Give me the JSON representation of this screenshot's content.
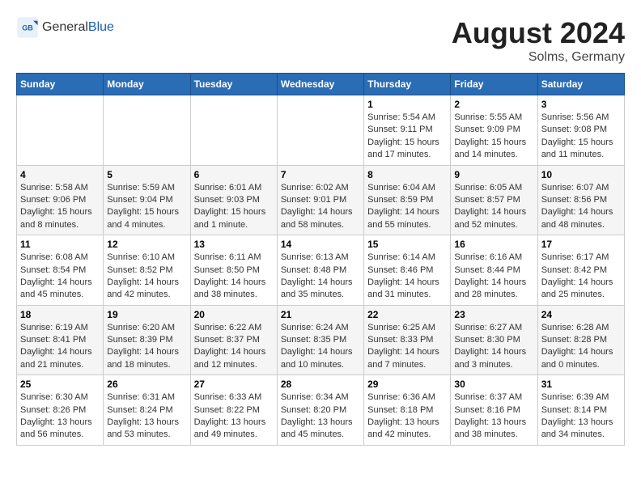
{
  "header": {
    "logo_general": "General",
    "logo_blue": "Blue",
    "month_year": "August 2024",
    "location": "Solms, Germany"
  },
  "weekdays": [
    "Sunday",
    "Monday",
    "Tuesday",
    "Wednesday",
    "Thursday",
    "Friday",
    "Saturday"
  ],
  "weeks": [
    [
      {
        "day": "",
        "info": ""
      },
      {
        "day": "",
        "info": ""
      },
      {
        "day": "",
        "info": ""
      },
      {
        "day": "",
        "info": ""
      },
      {
        "day": "1",
        "info": "Sunrise: 5:54 AM\nSunset: 9:11 PM\nDaylight: 15 hours\nand 17 minutes."
      },
      {
        "day": "2",
        "info": "Sunrise: 5:55 AM\nSunset: 9:09 PM\nDaylight: 15 hours\nand 14 minutes."
      },
      {
        "day": "3",
        "info": "Sunrise: 5:56 AM\nSunset: 9:08 PM\nDaylight: 15 hours\nand 11 minutes."
      }
    ],
    [
      {
        "day": "4",
        "info": "Sunrise: 5:58 AM\nSunset: 9:06 PM\nDaylight: 15 hours\nand 8 minutes."
      },
      {
        "day": "5",
        "info": "Sunrise: 5:59 AM\nSunset: 9:04 PM\nDaylight: 15 hours\nand 4 minutes."
      },
      {
        "day": "6",
        "info": "Sunrise: 6:01 AM\nSunset: 9:03 PM\nDaylight: 15 hours\nand 1 minute."
      },
      {
        "day": "7",
        "info": "Sunrise: 6:02 AM\nSunset: 9:01 PM\nDaylight: 14 hours\nand 58 minutes."
      },
      {
        "day": "8",
        "info": "Sunrise: 6:04 AM\nSunset: 8:59 PM\nDaylight: 14 hours\nand 55 minutes."
      },
      {
        "day": "9",
        "info": "Sunrise: 6:05 AM\nSunset: 8:57 PM\nDaylight: 14 hours\nand 52 minutes."
      },
      {
        "day": "10",
        "info": "Sunrise: 6:07 AM\nSunset: 8:56 PM\nDaylight: 14 hours\nand 48 minutes."
      }
    ],
    [
      {
        "day": "11",
        "info": "Sunrise: 6:08 AM\nSunset: 8:54 PM\nDaylight: 14 hours\nand 45 minutes."
      },
      {
        "day": "12",
        "info": "Sunrise: 6:10 AM\nSunset: 8:52 PM\nDaylight: 14 hours\nand 42 minutes."
      },
      {
        "day": "13",
        "info": "Sunrise: 6:11 AM\nSunset: 8:50 PM\nDaylight: 14 hours\nand 38 minutes."
      },
      {
        "day": "14",
        "info": "Sunrise: 6:13 AM\nSunset: 8:48 PM\nDaylight: 14 hours\nand 35 minutes."
      },
      {
        "day": "15",
        "info": "Sunrise: 6:14 AM\nSunset: 8:46 PM\nDaylight: 14 hours\nand 31 minutes."
      },
      {
        "day": "16",
        "info": "Sunrise: 6:16 AM\nSunset: 8:44 PM\nDaylight: 14 hours\nand 28 minutes."
      },
      {
        "day": "17",
        "info": "Sunrise: 6:17 AM\nSunset: 8:42 PM\nDaylight: 14 hours\nand 25 minutes."
      }
    ],
    [
      {
        "day": "18",
        "info": "Sunrise: 6:19 AM\nSunset: 8:41 PM\nDaylight: 14 hours\nand 21 minutes."
      },
      {
        "day": "19",
        "info": "Sunrise: 6:20 AM\nSunset: 8:39 PM\nDaylight: 14 hours\nand 18 minutes."
      },
      {
        "day": "20",
        "info": "Sunrise: 6:22 AM\nSunset: 8:37 PM\nDaylight: 14 hours\nand 12 minutes."
      },
      {
        "day": "21",
        "info": "Sunrise: 6:24 AM\nSunset: 8:35 PM\nDaylight: 14 hours\nand 10 minutes."
      },
      {
        "day": "22",
        "info": "Sunrise: 6:25 AM\nSunset: 8:33 PM\nDaylight: 14 hours\nand 7 minutes."
      },
      {
        "day": "23",
        "info": "Sunrise: 6:27 AM\nSunset: 8:30 PM\nDaylight: 14 hours\nand 3 minutes."
      },
      {
        "day": "24",
        "info": "Sunrise: 6:28 AM\nSunset: 8:28 PM\nDaylight: 14 hours\nand 0 minutes."
      }
    ],
    [
      {
        "day": "25",
        "info": "Sunrise: 6:30 AM\nSunset: 8:26 PM\nDaylight: 13 hours\nand 56 minutes."
      },
      {
        "day": "26",
        "info": "Sunrise: 6:31 AM\nSunset: 8:24 PM\nDaylight: 13 hours\nand 53 minutes."
      },
      {
        "day": "27",
        "info": "Sunrise: 6:33 AM\nSunset: 8:22 PM\nDaylight: 13 hours\nand 49 minutes."
      },
      {
        "day": "28",
        "info": "Sunrise: 6:34 AM\nSunset: 8:20 PM\nDaylight: 13 hours\nand 45 minutes."
      },
      {
        "day": "29",
        "info": "Sunrise: 6:36 AM\nSunset: 8:18 PM\nDaylight: 13 hours\nand 42 minutes."
      },
      {
        "day": "30",
        "info": "Sunrise: 6:37 AM\nSunset: 8:16 PM\nDaylight: 13 hours\nand 38 minutes."
      },
      {
        "day": "31",
        "info": "Sunrise: 6:39 AM\nSunset: 8:14 PM\nDaylight: 13 hours\nand 34 minutes."
      }
    ]
  ]
}
